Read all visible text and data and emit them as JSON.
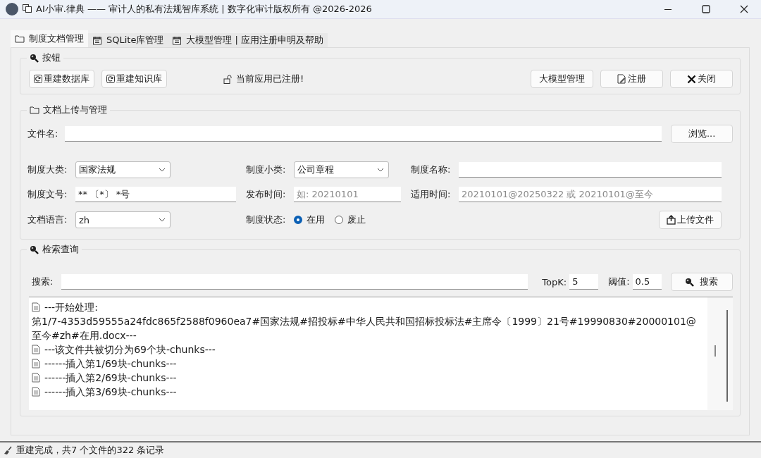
{
  "window": {
    "title": "AI小审.律典 —— 审计人的私有法规智库系统 | 数字化审计版权所有 @2026-2026"
  },
  "tabs": [
    {
      "label": "制度文档管理",
      "selected": true
    },
    {
      "label": "SQLite库管理",
      "selected": false
    },
    {
      "label": "大模型管理 | 应用注册申明及帮助",
      "selected": false
    }
  ],
  "buttons_group": {
    "title": "按钮",
    "left_buttons": [
      "重建数据库",
      "重建知识库"
    ],
    "status": "当前应用已注册!",
    "right_buttons": [
      "大模型管理",
      "注册",
      "关闭"
    ]
  },
  "upload": {
    "title": "文档上传与管理",
    "file_label": "文件名:",
    "browse": "浏览...",
    "rows": [
      [
        {
          "label": "制度大类:",
          "kind": "select",
          "value": "国家法规"
        },
        {
          "label": "制度小类:",
          "kind": "select",
          "value": "公司章程"
        },
        {
          "label": "制度名称:",
          "kind": "text"
        }
      ],
      [
        {
          "label": "制度文号:",
          "kind": "text",
          "value": "** 〔*〕 *号"
        },
        {
          "label": "发布时间:",
          "kind": "text",
          "placeholder": "如: 20210101"
        },
        {
          "label": "适用时间:",
          "kind": "text",
          "placeholder": "20210101@20250322 或 20210101@至今"
        }
      ],
      [
        {
          "label": "文档语言:",
          "kind": "select",
          "value": "zh"
        },
        {
          "label": "制度状态:",
          "kind": "radio",
          "options": [
            {
              "label": "在用",
              "selected": true
            },
            {
              "label": "废止",
              "selected": false
            }
          ]
        },
        {
          "label": "上传文件",
          "kind": "button"
        }
      ]
    ]
  },
  "search": {
    "title": "检索查询",
    "label": "搜索:",
    "topk_label": "TopK:",
    "topk": "5",
    "threshold_label": "阈值:",
    "threshold": "0.5",
    "button": "搜索",
    "log": [
      {
        "kind": "entry",
        "text": "---开始处理:"
      },
      {
        "kind": "continuation",
        "text": "第1/7-4353d59555a24fdc865f2588f0960ea7#国家法规#招投标#中华人民共和国招标投标法#主席令〔1999〕21号#19990830#20000101@至今#zh#在用.docx---"
      },
      {
        "kind": "entry",
        "text": "---该文件共被切分为69个块-chunks---"
      },
      {
        "kind": "entry",
        "text": "------插入第1/69块-chunks---"
      },
      {
        "kind": "entry",
        "text": "------插入第2/69块-chunks---"
      },
      {
        "kind": "entry",
        "text": "------插入第3/69块-chunks---"
      }
    ]
  },
  "status_bar": {
    "text": "重建完成，共7 个文件的322 条记录"
  }
}
